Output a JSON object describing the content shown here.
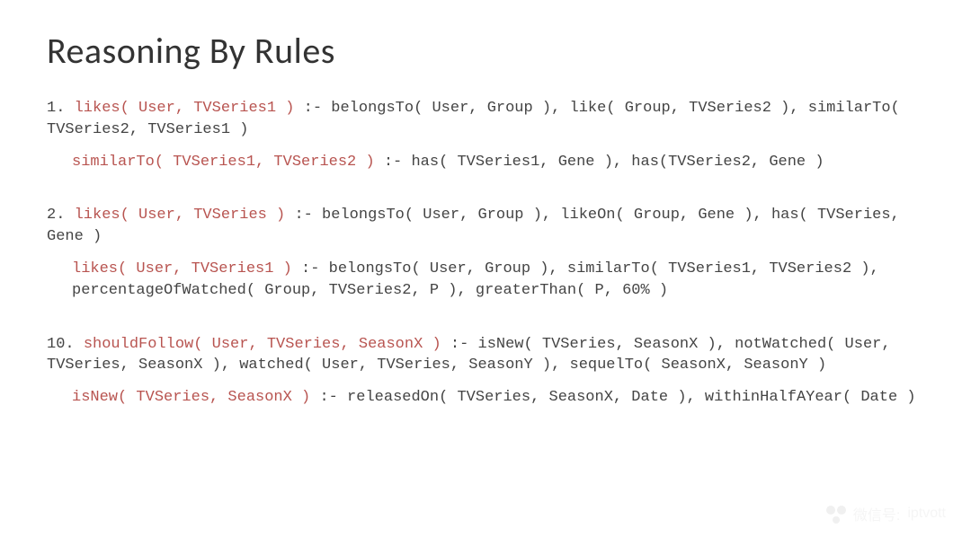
{
  "title": "Reasoning By Rules",
  "rules": [
    {
      "num": "1.",
      "head_hl": "likes( User, TVSeries1 )",
      "body": " :- belongsTo( User, Group ), like( Group, TVSeries2 ), similarTo( TVSeries2, TVSeries1 )",
      "sub": {
        "head_hl": "similarTo( TVSeries1, TVSeries2 )",
        "body": " :- has( TVSeries1, Gene ), has(TVSeries2, Gene )"
      }
    },
    {
      "num": "2.",
      "head_hl": "likes( User, TVSeries )",
      "body": " :- belongsTo( User, Group ), likeOn( Group, Gene ), has( TVSeries, Gene )",
      "sub": {
        "head_hl": "likes( User, TVSeries1 )",
        "body": " :- belongsTo( User, Group ), similarTo( TVSeries1, TVSeries2 ), percentageOfWatched( Group, TVSeries2, P ), greaterThan( P, 60% )"
      }
    },
    {
      "num": "10.",
      "head_hl": "shouldFollow( User, TVSeries, SeasonX )",
      "body": " :- isNew( TVSeries, SeasonX ), notWatched( User, TVSeries, SeasonX ), watched( User, TVSeries, SeasonY ), sequelTo( SeasonX, SeasonY )",
      "sub": {
        "head_hl": "isNew( TVSeries, SeasonX )",
        "body": " :- releasedOn( TVSeries, SeasonX, Date ), withinHalfAYear( Date )"
      }
    }
  ],
  "footer": {
    "label": "微信号:",
    "value": "iptvott"
  }
}
